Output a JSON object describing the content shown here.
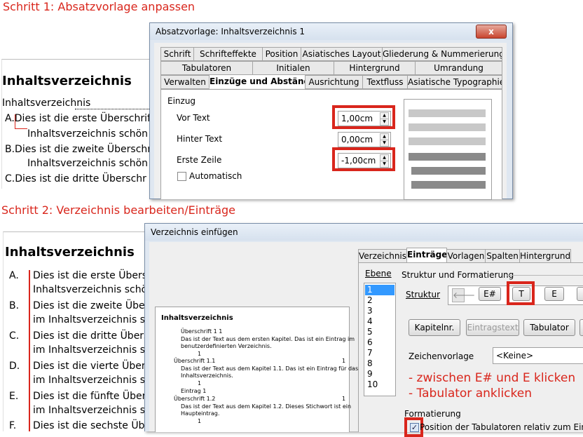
{
  "step1": {
    "title": "Schritt 1: Absatzvorlage anpassen"
  },
  "step2": {
    "title": "Schritt 2: Verzeichnis bearbeiten/Einträge"
  },
  "doc1": {
    "heading": "Inhaltsverzeichnis",
    "lines": [
      "Inhaltsverzeichnis",
      "A.Dies ist die erste Überschrift",
      "Inhaltsverzeichnis schön",
      "B.Dies ist die zweite Überschr",
      "Inhaltsverzeichnis schön",
      "C.Dies ist die dritte Überschr"
    ]
  },
  "doc2": {
    "heading": "Inhaltsverzeichnis",
    "items": [
      {
        "letter": "A.",
        "text": "Dies ist die erste Übers",
        "sub": "Inhaltsverzeichnis schö"
      },
      {
        "letter": "B.",
        "text": "Dies ist die zweite Über",
        "sub": "im Inhaltsverzeichnis s"
      },
      {
        "letter": "C.",
        "text": "Dies ist die dritte Übers",
        "sub": "im Inhaltsverzeichnis s"
      },
      {
        "letter": "D.",
        "text": "Dies ist die vierte Über",
        "sub": "im Inhaltsverzeichnis s"
      },
      {
        "letter": "E.",
        "text": "Dies ist die fünfte Über",
        "sub": "im Inhaltsverzeichnis s"
      },
      {
        "letter": "F.",
        "text": "Dies ist die sechste Übe",
        "sub": ""
      }
    ]
  },
  "dialog1": {
    "title": "Absatzvorlage: Inhaltsverzeichnis 1",
    "close": "x",
    "tabs_row1": [
      "Schrift",
      "Schrifteffekte",
      "Position",
      "Asiatisches Layout",
      "Gliederung & Nummerierung"
    ],
    "tabs_row2": [
      "Tabulatoren",
      "Initialen",
      "Hintergrund",
      "Umrandung"
    ],
    "tabs_row3": [
      "Verwalten",
      "Einzüge und Abstände",
      "Ausrichtung",
      "Textfluss",
      "Asiatische Typographie"
    ],
    "section": "Einzug",
    "vor_text": {
      "label": "Vor Text",
      "value": "1,00cm"
    },
    "hinter_text": {
      "label": "Hinter Text",
      "value": "0,00cm"
    },
    "erste_zeile": {
      "label": "Erste Zeile",
      "value": "-1,00cm"
    },
    "automatisch": "Automatisch"
  },
  "dialog2": {
    "title": "Verzeichnis einfügen",
    "tabs": [
      "Verzeichnis",
      "Einträge",
      "Vorlagen",
      "Spalten",
      "Hintergrund"
    ],
    "ebene_label": "Ebene",
    "levels": [
      "1",
      "2",
      "3",
      "4",
      "5",
      "6",
      "7",
      "8",
      "9",
      "10"
    ],
    "struktur_section": "Struktur und Formatierung",
    "struktur_label": "Struktur",
    "struktur_tokens": [
      "E#",
      "T",
      "E"
    ],
    "buttons": {
      "kapitel": "Kapitelnr.",
      "eintrag": "Eintragstext",
      "tabulator": "Tabulator"
    },
    "zeichen_label": "Zeichenvorlage",
    "zeichen_value": "<Keine>",
    "annotation1": "- zwischen E# und E klicken",
    "annotation2": "- Tabulator anklicken",
    "formatierung": "Formatierung",
    "checkbox_label": "Position der Tabulatoren relativ zum Einzug a",
    "preview": {
      "heading": "Inhaltsverzeichnis",
      "lines": [
        "Überschrift 1          1",
        "Das ist der Text aus dem ersten Kapitel. Das ist ein Eintrag im",
        "benutzerdefinierten Verzeichnis.",
        "1",
        "Überschrift 1.1",
        "Das ist der Text aus dem Kapitel 1.1. Das ist ein Eintrag für das",
        "Inhaltsverzeichnis.",
        "1",
        "Eintrag      1",
        "Überschrift 1.2",
        "Das ist der Text aus dem Kapitel 1.2. Dieses Stichwort ist ein",
        "Haupteintrag.",
        "1"
      ]
    }
  }
}
